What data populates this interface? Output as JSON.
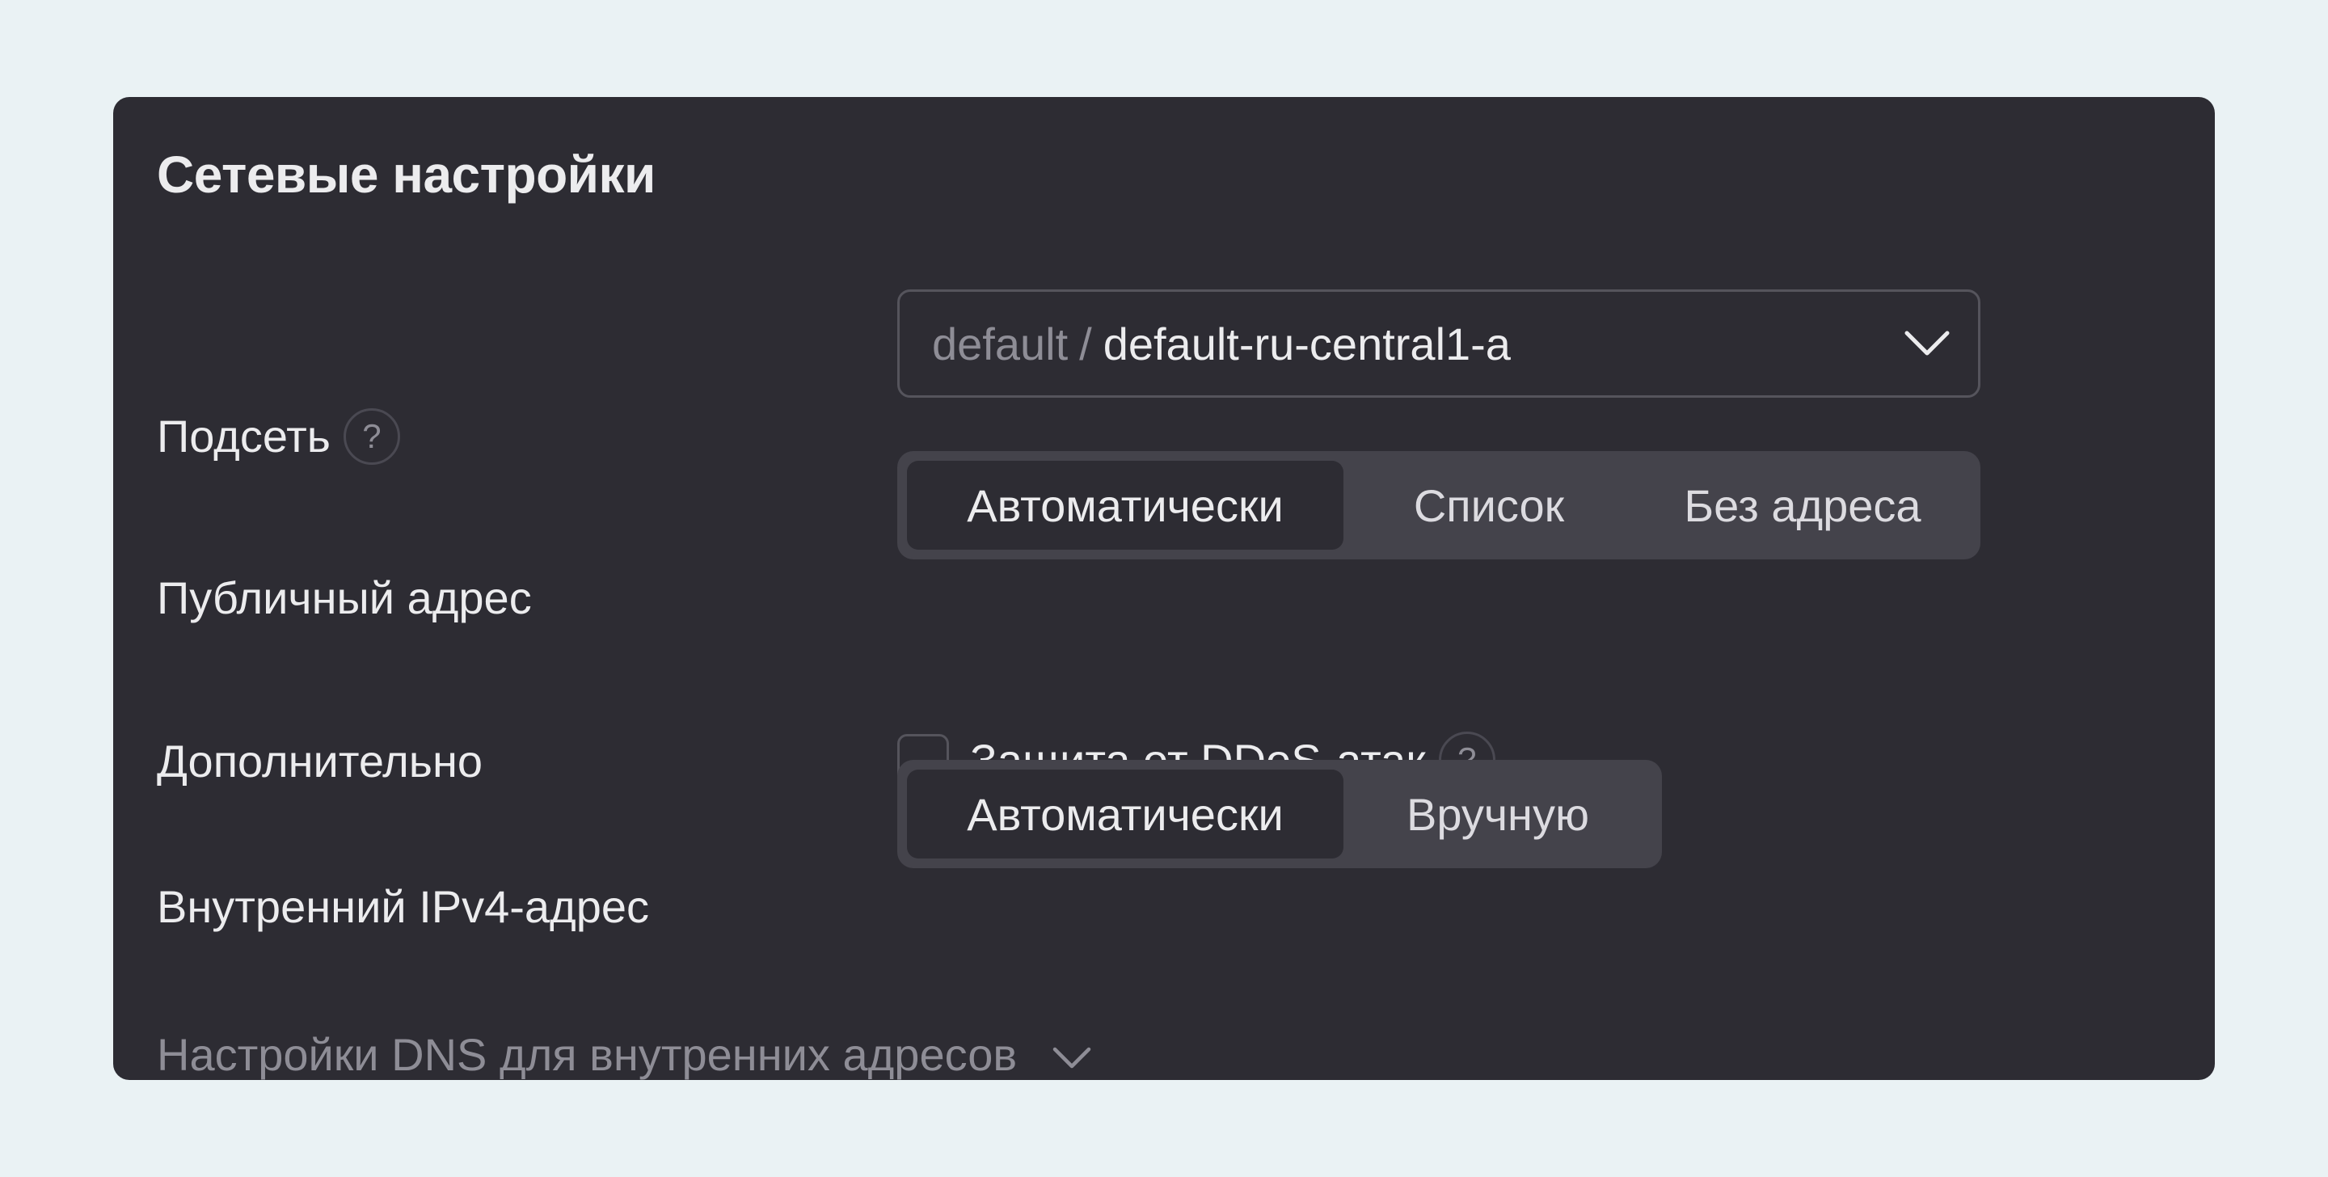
{
  "title": "Сетевые настройки",
  "subnet": {
    "label": "Подсеть",
    "help": "?",
    "folder": "default",
    "separator": "/",
    "value": "default-ru-central1-a"
  },
  "public_address": {
    "label": "Публичный адрес",
    "options": [
      "Автоматически",
      "Список",
      "Без адреса"
    ],
    "selected": "Автоматически"
  },
  "additional": {
    "label": "Дополнительно",
    "ddos_label": "Защита от DDoS-атак",
    "ddos_checked": false,
    "help": "?"
  },
  "internal_ipv4": {
    "label": "Внутренний IPv4-адрес",
    "options": [
      "Автоматически",
      "Вручную"
    ],
    "selected": "Автоматически"
  },
  "dns_settings": {
    "label": "Настройки DNS для внутренних адресов",
    "expanded": false
  },
  "icons": {
    "subnet_dropdown": "chevron-down-icon",
    "dns_expand": "chevron-down-icon",
    "help": "question-circle-icon"
  },
  "colors": {
    "page_background": "#eaf2f4",
    "panel_background": "#2d2c33",
    "segment_track": "#44434b",
    "text_primary": "#ececee",
    "text_muted": "#8e8d96"
  }
}
